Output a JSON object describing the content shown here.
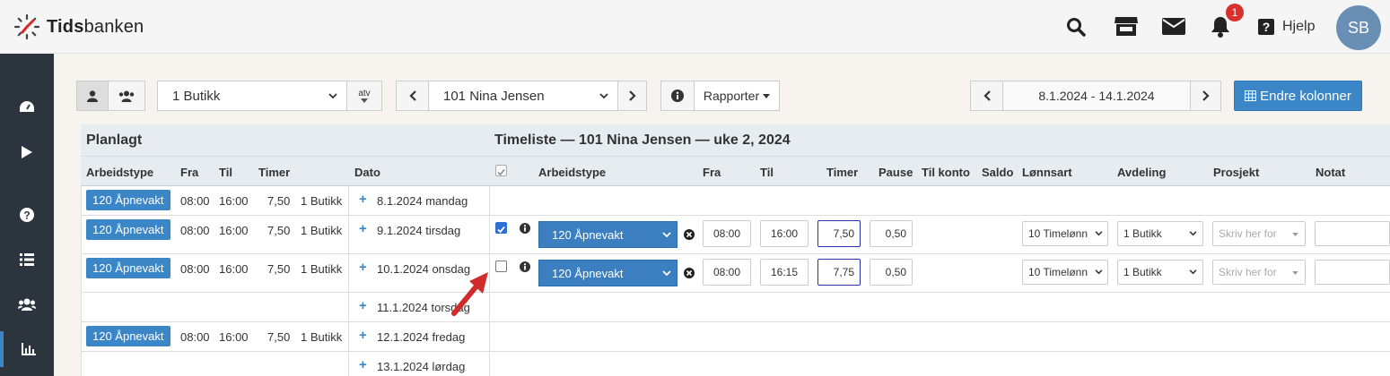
{
  "brand": {
    "name_bold": "Tids",
    "name_rest": "banken"
  },
  "header": {
    "notification_count": "1",
    "help_label": "Hjelp",
    "avatar_initials": "SB"
  },
  "toolbar": {
    "store_select": "1 Butikk",
    "atv_label": "atv",
    "employee_select": "101 Nina Jensen",
    "reports_label": "Rapporter",
    "date_range": "8.1.2024 - 14.1.2024",
    "change_columns_label": "Endre kolonner"
  },
  "planned": {
    "title": "Planlagt",
    "columns": [
      "Arbeidstype",
      "Fra",
      "Til",
      "Timer",
      "Dato"
    ],
    "rows": [
      {
        "type": "120 Åpnevakt",
        "from": "08:00",
        "to": "16:00",
        "hours": "7,50",
        "dept": "1 Butikk",
        "date": "8.1.2024 mandag"
      },
      {
        "type": "120 Åpnevakt",
        "from": "08:00",
        "to": "16:00",
        "hours": "7,50",
        "dept": "1 Butikk",
        "date": "9.1.2024 tirsdag"
      },
      {
        "type": "120 Åpnevakt",
        "from": "08:00",
        "to": "16:00",
        "hours": "7,50",
        "dept": "1 Butikk",
        "date": "10.1.2024 onsdag"
      },
      {
        "type": "",
        "from": "",
        "to": "",
        "hours": "",
        "dept": "",
        "date": "11.1.2024 torsdag"
      },
      {
        "type": "120 Åpnevakt",
        "from": "08:00",
        "to": "16:00",
        "hours": "7,50",
        "dept": "1 Butikk",
        "date": "12.1.2024 fredag"
      },
      {
        "type": "",
        "from": "",
        "to": "",
        "hours": "",
        "dept": "",
        "date": "13.1.2024 lørdag"
      }
    ]
  },
  "timesheet": {
    "title": "Timeliste — 101 Nina Jensen — uke 2, 2024",
    "columns": [
      "Arbeidstype",
      "Fra",
      "Til",
      "Timer",
      "Pause",
      "Til konto",
      "Saldo",
      "Lønnsart",
      "Avdeling",
      "Prosjekt",
      "Notat"
    ],
    "rows": [
      {
        "checked": true,
        "type": "120 Åpnevakt",
        "from": "08:00",
        "to": "16:00",
        "hours": "7,50",
        "pause": "0,50",
        "wage": "10 Timelønn",
        "dept": "1 Butikk",
        "project_placeholder": "Skriv her for",
        "note": ""
      },
      {
        "checked": false,
        "type": "120 Åpnevakt",
        "from": "08:00",
        "to": "16:15",
        "hours": "7,75",
        "pause": "0,50",
        "wage": "10 Timelønn",
        "dept": "1 Butikk",
        "project_placeholder": "Skriv her for",
        "note": ""
      }
    ]
  },
  "colors": {
    "accent": "#3b86c6",
    "sidebar": "#2c343d",
    "badge": "#d9302c",
    "arrow": "#d22b2b"
  }
}
